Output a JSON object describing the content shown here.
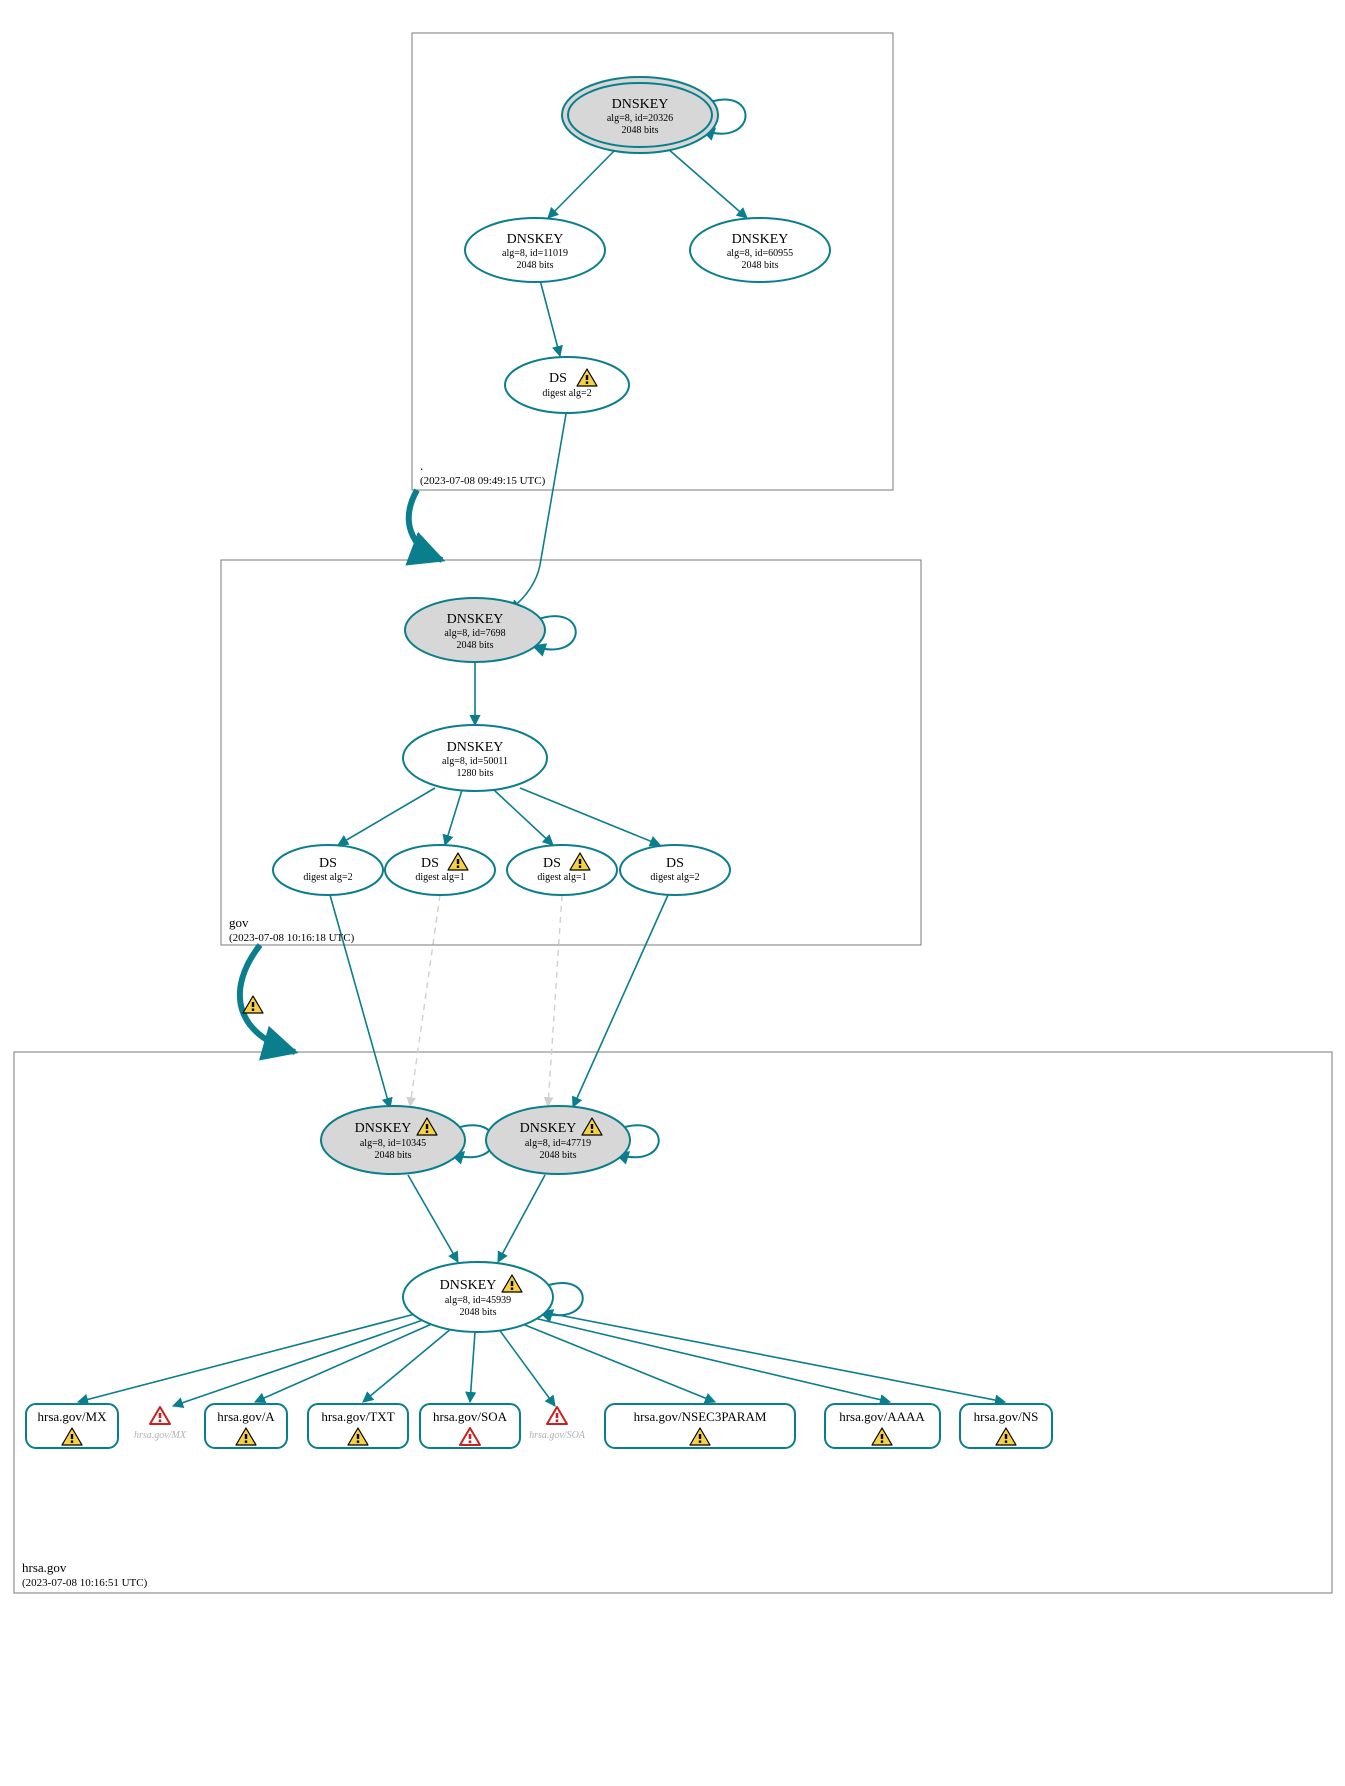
{
  "colors": {
    "teal": "#0a7e8c",
    "grayStroke": "#7a7a7a",
    "nodeFillGray": "#d7d7d7",
    "nodeFillWhite": "#ffffff",
    "ghost": "#cfcfcf",
    "warnFill": "#f6d142",
    "warnStroke": "#000000",
    "errFill": "#ffffff",
    "errStroke": "#cc1f1f"
  },
  "zones": {
    "root": {
      "label": ".",
      "time": "(2023-07-08 09:49:15 UTC)"
    },
    "gov": {
      "label": "gov",
      "time": "(2023-07-08 10:16:18 UTC)"
    },
    "hrsa": {
      "label": "hrsa.gov",
      "time": "(2023-07-08 10:16:51 UTC)"
    }
  },
  "root": {
    "ksk": {
      "title": "DNSKEY",
      "line1": "alg=8, id=20326",
      "line2": "2048 bits"
    },
    "zsk1": {
      "title": "DNSKEY",
      "line1": "alg=8, id=11019",
      "line2": "2048 bits"
    },
    "zsk2": {
      "title": "DNSKEY",
      "line1": "alg=8, id=60955",
      "line2": "2048 bits"
    },
    "ds": {
      "title": "DS",
      "line1": "digest alg=2"
    }
  },
  "gov": {
    "ksk": {
      "title": "DNSKEY",
      "line1": "alg=8, id=7698",
      "line2": "2048 bits"
    },
    "zsk": {
      "title": "DNSKEY",
      "line1": "alg=8, id=50011",
      "line2": "1280 bits"
    },
    "ds1": {
      "title": "DS",
      "line1": "digest alg=2"
    },
    "ds2": {
      "title": "DS",
      "line1": "digest alg=1"
    },
    "ds3": {
      "title": "DS",
      "line1": "digest alg=1"
    },
    "ds4": {
      "title": "DS",
      "line1": "digest alg=2"
    }
  },
  "hrsa": {
    "ksk1": {
      "title": "DNSKEY",
      "line1": "alg=8, id=10345",
      "line2": "2048 bits"
    },
    "ksk2": {
      "title": "DNSKEY",
      "line1": "alg=8, id=47719",
      "line2": "2048 bits"
    },
    "zsk": {
      "title": "DNSKEY",
      "line1": "alg=8, id=45939",
      "line2": "2048 bits"
    },
    "rr": {
      "mx": "hrsa.gov/MX",
      "a": "hrsa.gov/A",
      "txt": "hrsa.gov/TXT",
      "soa": "hrsa.gov/SOA",
      "nsec3": "hrsa.gov/NSEC3PARAM",
      "aaaa": "hrsa.gov/AAAA",
      "ns": "hrsa.gov/NS"
    },
    "ghost": {
      "mx": "hrsa.gov/MX",
      "soa": "hrsa.gov/SOA"
    }
  }
}
